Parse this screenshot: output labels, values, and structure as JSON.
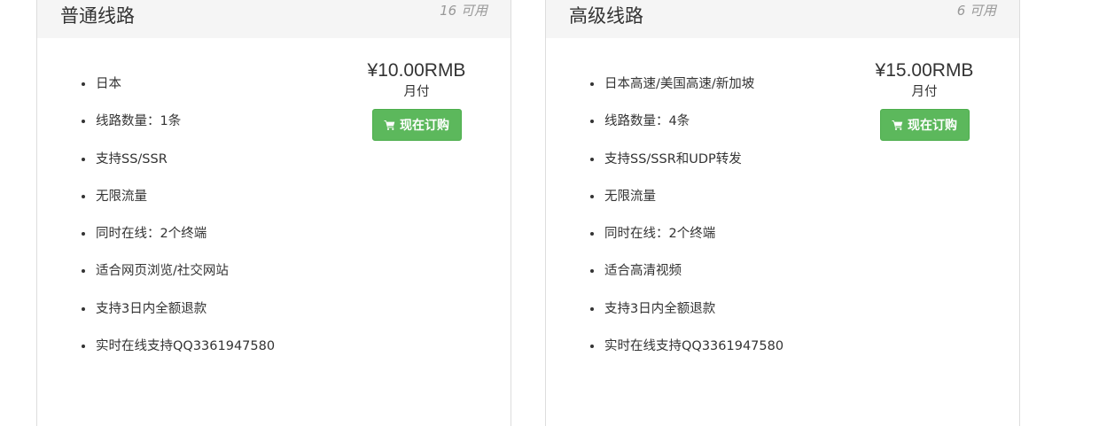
{
  "plans": [
    {
      "title": "普通线路",
      "availability": "16 可用",
      "price": "¥10.00RMB",
      "period": "月付",
      "buy_label": "现在订购",
      "features": [
        "日本",
        "线路数量：1条",
        "支持SS/SSR",
        "无限流量",
        "同时在线：2个终端",
        "适合网页浏览/社交网站",
        "支持3日内全额退款",
        "实时在线支持QQ3361947580"
      ]
    },
    {
      "title": "高级线路",
      "availability": "6 可用",
      "price": "¥15.00RMB",
      "period": "月付",
      "buy_label": "现在订购",
      "features": [
        "日本高速/美国高速/新加坡",
        "线路数量：4条",
        "支持SS/SSR和UDP转发",
        "无限流量",
        "同时在线：2个终端",
        "适合高清视频",
        "支持3日内全额退款",
        "实时在线支持QQ3361947580"
      ]
    }
  ],
  "icons": {
    "buy_icon": "shopping-cart-icon"
  },
  "colors": {
    "buy_button": "#5cb85c",
    "header_bg": "#f5f5f5",
    "availability_text": "#999999"
  }
}
